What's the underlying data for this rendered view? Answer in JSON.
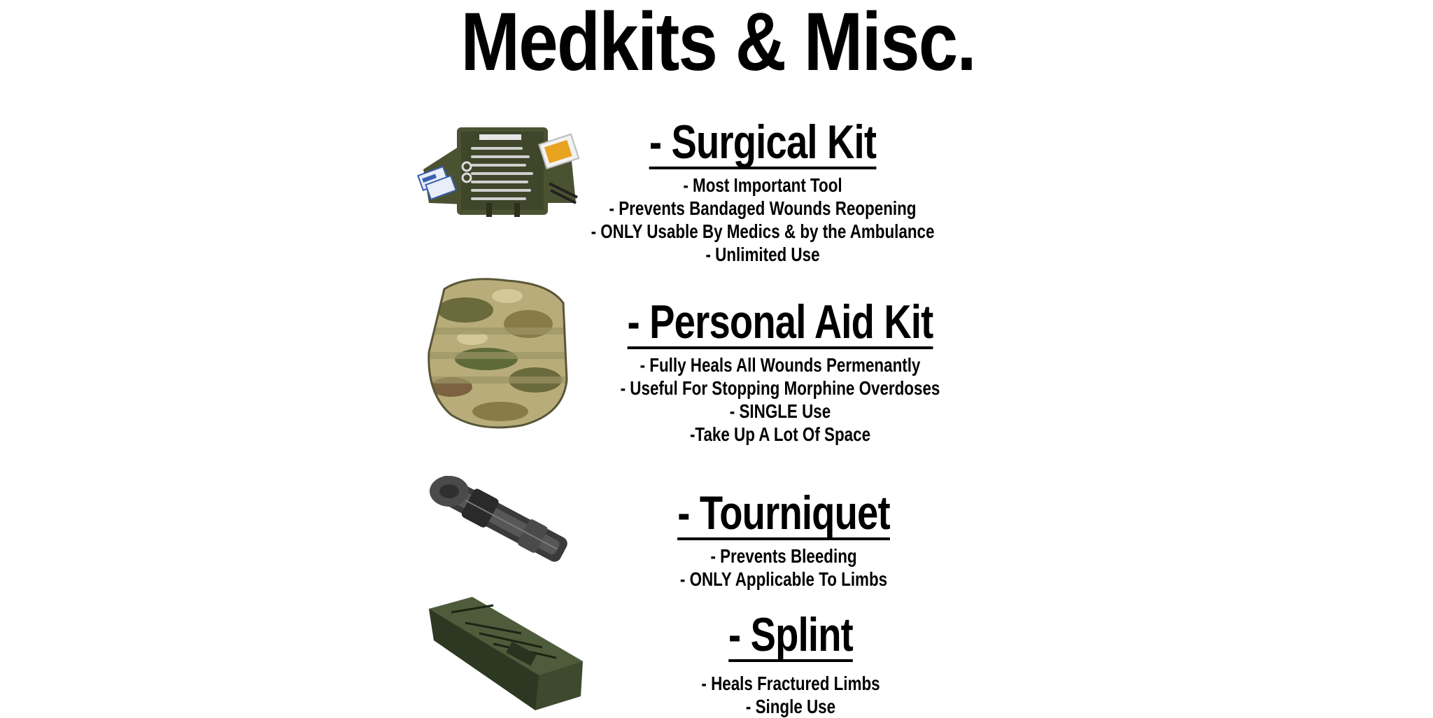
{
  "title": "Medkits & Misc.",
  "items": [
    {
      "name": "- Surgical Kit",
      "bullets": [
        "- Most Important Tool",
        "- Prevents Bandaged Wounds Reopening",
        "- ONLY Usable By Medics & by the Ambulance",
        "- Unlimited Use"
      ],
      "image": "surgical-kit-image"
    },
    {
      "name": "- Personal Aid Kit",
      "bullets": [
        "- Fully Heals All Wounds Permenantly",
        "- Useful For Stopping Morphine Overdoses",
        "- SINGLE Use",
        "-Take Up A Lot Of Space"
      ],
      "image": "camo-pouch-image"
    },
    {
      "name": "- Tourniquet",
      "bullets": [
        "- Prevents Bleeding",
        "- ONLY Applicable To Limbs"
      ],
      "image": "tourniquet-image"
    },
    {
      "name": "- Splint",
      "bullets": [
        "- Heals Fractured Limbs",
        "- Single Use"
      ],
      "image": "splint-image"
    }
  ],
  "colors": {
    "olive": "#4b5232",
    "camo_light": "#b8ad7a",
    "camo_dark": "#6b6a3c",
    "tourniquet": "#3a3a3a",
    "splint": "#3d4a2e"
  }
}
